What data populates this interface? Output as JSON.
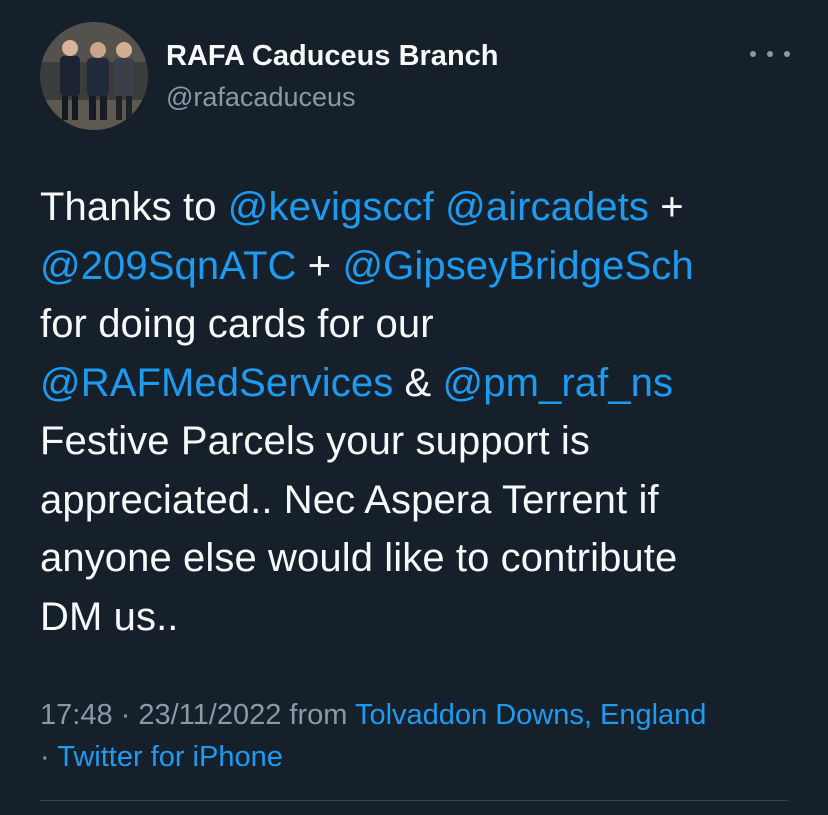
{
  "author": {
    "name": "RAFA Caduceus Branch",
    "handle": "@rafacaduceus",
    "avatar_icon": "group-photo-avatar"
  },
  "more_menu": {
    "icon": "more-horizontal-icon"
  },
  "tweet": {
    "lines": [
      [
        {
          "t": "Thanks to ",
          "m": false
        },
        {
          "t": "@kevigsccf",
          "m": true
        },
        {
          "t": " ",
          "m": false
        },
        {
          "t": "@aircadets",
          "m": true
        },
        {
          "t": " +",
          "m": false
        }
      ],
      [
        {
          "t": "@209SqnATC",
          "m": true
        },
        {
          "t": " + ",
          "m": false
        },
        {
          "t": "@GipseyBridgeSch",
          "m": true
        }
      ],
      [
        {
          "t": "for doing cards for our",
          "m": false
        }
      ],
      [
        {
          "t": "@RAFMedServices",
          "m": true
        },
        {
          "t": " & ",
          "m": false
        },
        {
          "t": "@pm_raf_ns",
          "m": true
        }
      ],
      [
        {
          "t": "Festive Parcels your support is",
          "m": false
        }
      ],
      [
        {
          "t": "appreciated.. Nec Aspera Terrent if",
          "m": false
        }
      ],
      [
        {
          "t": "anyone else would like to contribute",
          "m": false
        }
      ],
      [
        {
          "t": "DM us..",
          "m": false
        }
      ]
    ]
  },
  "meta": {
    "time": "17:48",
    "sep1": " · ",
    "date": "23/11/2022",
    "from_label": " from ",
    "location": "Tolvaddon Downs, England",
    "sep2": "· ",
    "source": "Twitter for iPhone"
  },
  "colors": {
    "background": "#15202b",
    "text": "#f7f9f9",
    "muted": "#8b98a5",
    "link": "#1d9bf0"
  }
}
